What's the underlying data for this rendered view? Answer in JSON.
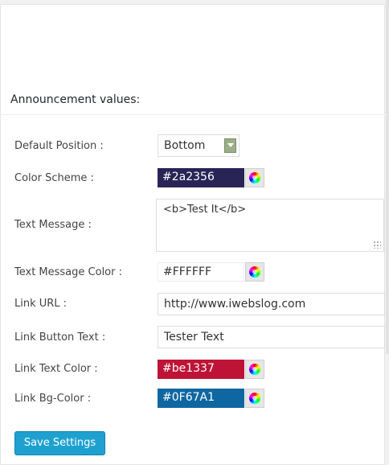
{
  "section": {
    "title": "Announcement values:"
  },
  "fields": {
    "default_position": {
      "label": "Default Position :",
      "value": "Bottom"
    },
    "color_scheme": {
      "label": "Color Scheme :",
      "value": "#2a2356",
      "color": "#2a2356"
    },
    "text_message": {
      "label": "Text Message :",
      "value": "<b>Test It</b>"
    },
    "text_message_color": {
      "label": "Text Message Color :",
      "value": "#FFFFFF",
      "color": "#FFFFFF"
    },
    "link_url": {
      "label": "Link URL :",
      "value": "http://www.iwebslog.com"
    },
    "link_button_text": {
      "label": "Link Button Text :",
      "value": "Tester Text"
    },
    "link_text_color": {
      "label": "Link Text Color :",
      "value": "#be1337",
      "color": "#be1337"
    },
    "link_bg_color": {
      "label": "Link Bg-Color :",
      "value": "#0F67A1",
      "color": "#0F67A1"
    }
  },
  "icons": {
    "color_picker": "color-wheel-icon",
    "resize": "resize-handle-icon",
    "dropdown": "chevron-down-icon"
  },
  "actions": {
    "save_label": "Save Settings"
  },
  "colors": {
    "accent": "#1fa1d0",
    "select_arrow": "#9caf88"
  }
}
